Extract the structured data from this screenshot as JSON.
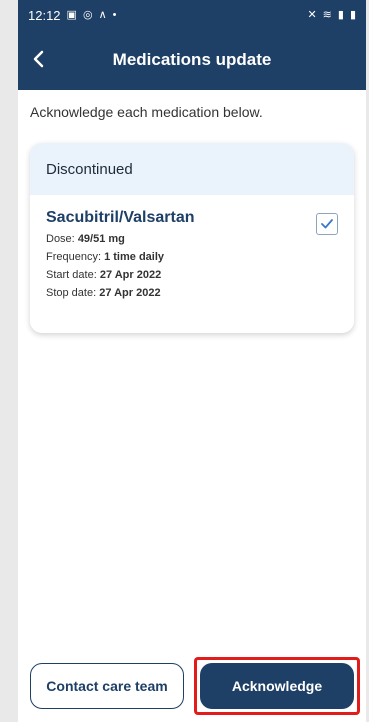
{
  "status": {
    "time": "12:12"
  },
  "appbar": {
    "title": "Medications update"
  },
  "intro": "Acknowledge each medication below.",
  "card": {
    "section": "Discontinued",
    "medication": {
      "name": "Sacubitril/Valsartan",
      "dose_label": "Dose:",
      "dose_value": "49/51 mg",
      "frequency_label": "Frequency:",
      "frequency_value": "1 time daily",
      "start_label": "Start date:",
      "start_value": "27 Apr 2022",
      "stop_label": "Stop date:",
      "stop_value": "27 Apr 2022",
      "checked": true
    }
  },
  "buttons": {
    "contact": "Contact care team",
    "acknowledge": "Acknowledge"
  },
  "colors": {
    "brand": "#1e3f66",
    "card_header": "#eaf2fb",
    "highlight": "#e21b1b"
  },
  "icons": [
    "back-arrow-icon",
    "check-icon",
    "signal-icon",
    "wifi-icon",
    "battery-icon"
  ]
}
